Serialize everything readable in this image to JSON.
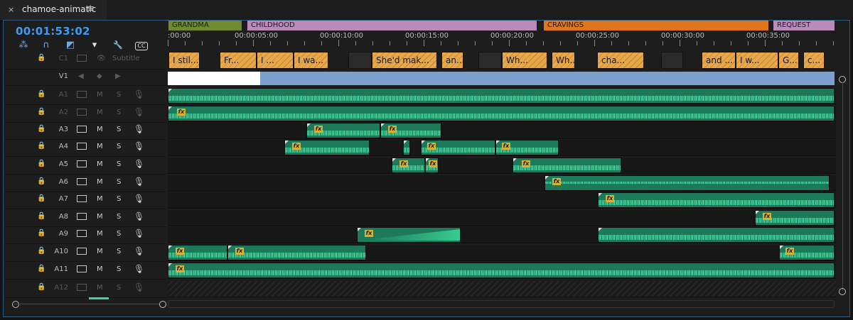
{
  "window": {
    "tab_title": "chamoe-animatic",
    "close_glyph": "×",
    "menu_glyph": "≡"
  },
  "timecode": "00:01:53:02",
  "tools": [
    {
      "name": "snap-icon",
      "glyph": "⁂"
    },
    {
      "name": "magnet-icon",
      "glyph": "∩"
    },
    {
      "name": "linked-selection-icon",
      "glyph": "◩"
    },
    {
      "name": "marker-icon",
      "glyph": "▾"
    },
    {
      "name": "wrench-icon",
      "glyph": "🔧"
    },
    {
      "name": "cc-icon",
      "glyph": "CC"
    }
  ],
  "ruler": {
    "labels": [
      ":00:00",
      "00:00:05:00",
      "00:00:10:00",
      "00:00:15:00",
      "00:00:20:00",
      "00:00:25:00",
      "00:00:30:00",
      "00:00:35:00"
    ]
  },
  "markers": [
    {
      "label": "GRANDMA",
      "color": "#6f8a2f",
      "text_color": "#1a1a1a"
    },
    {
      "label": "CHILDHOOD",
      "color": "#b88bb8",
      "text_color": "#1a1a1a"
    },
    {
      "label": "CRAVINGS",
      "color": "#e0761c",
      "text_color": "#1a1a1a"
    },
    {
      "label": "REQUEST",
      "color": "#b88bb8",
      "text_color": "#1a1a1a"
    }
  ],
  "caption_track": {
    "name": "C1",
    "label": "Subtitle"
  },
  "captions": [
    "I stil...",
    "Fr...",
    "I ...",
    "I wa...",
    "She'd mak...",
    "an...",
    "Wh...",
    "Wh...",
    "cha...",
    "and ...",
    "I w...",
    "G...",
    "c..."
  ],
  "video_track": {
    "name": "V1"
  },
  "audio_tracks": [
    {
      "name": "A1",
      "locked": true,
      "m": "M",
      "s": "S"
    },
    {
      "name": "A2",
      "locked": true,
      "m": "M",
      "s": "S"
    },
    {
      "name": "A3",
      "locked": false,
      "m": "M",
      "s": "S"
    },
    {
      "name": "A4",
      "locked": false,
      "m": "M",
      "s": "S"
    },
    {
      "name": "A5",
      "locked": false,
      "m": "M",
      "s": "S"
    },
    {
      "name": "A6",
      "locked": false,
      "m": "M",
      "s": "S"
    },
    {
      "name": "A7",
      "locked": false,
      "m": "M",
      "s": "S"
    },
    {
      "name": "A8",
      "locked": false,
      "m": "M",
      "s": "S"
    },
    {
      "name": "A9",
      "locked": false,
      "m": "M",
      "s": "S"
    },
    {
      "name": "A10",
      "locked": false,
      "m": "M",
      "s": "S"
    },
    {
      "name": "A11",
      "locked": false,
      "m": "M",
      "s": "S"
    },
    {
      "name": "A12",
      "locked": true,
      "m": "M",
      "s": "S"
    }
  ],
  "fx_label": "fx",
  "colors": {
    "accent": "#3d9cf2",
    "audio_clip": "#1c7a5a",
    "caption_clip": "#e8a84a",
    "video_clip": "#7ba0cf"
  }
}
